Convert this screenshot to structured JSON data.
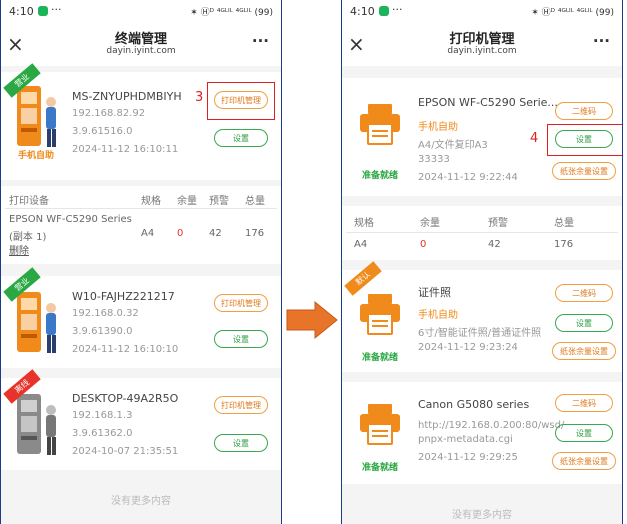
{
  "status": {
    "time": "4:10",
    "app_badge": "green-app-icon",
    "dots": "···",
    "right": "✶ Ⓗᴰ ⁴ᴳᴸᴵᴸ ⁴ᴳᴸᴵᴸ (99)"
  },
  "left": {
    "header": {
      "close": "×",
      "title": "终端管理",
      "subtitle": "dayin.iyint.com",
      "more": "···"
    },
    "terminals": [
      {
        "ribbon": "营业",
        "ribbon_color": "#2aa843",
        "name": "MS-ZNYUPHDMBIYH",
        "ip": "192.168.82.92",
        "version": "3.9.61516.0",
        "time": "2024-11-12 16:10:11",
        "label": "手机自助",
        "btn1": "打印机管理",
        "btn2": "设置",
        "annotation": "3"
      },
      {
        "ribbon": "营业",
        "ribbon_color": "#2aa843",
        "name": "W10-FAJHZ221217",
        "ip": "192.168.0.32",
        "version": "3.9.61390.0",
        "time": "2024-11-12 16:10:10",
        "btn1": "打印机管理",
        "btn2": "设置"
      },
      {
        "ribbon": "离线",
        "ribbon_color": "#e8332a",
        "name": "DESKTOP-49A2R5O",
        "ip": "192.168.1.3",
        "version": "3.9.61362.0",
        "time": "2024-10-07 21:35:51",
        "btn1": "打印机管理",
        "btn2": "设置"
      }
    ],
    "device_table": {
      "headers": [
        "打印设备",
        "规格",
        "余量",
        "预警",
        "总量"
      ],
      "row": {
        "device": "EPSON WF-C5290 Series",
        "device_sub": "(副本 1)",
        "spec": "A4",
        "remain": "0",
        "warn": "42",
        "total": "176",
        "delete": "删除"
      }
    },
    "footer": "没有更多内容"
  },
  "right": {
    "header": {
      "close": "×",
      "title": "打印机管理",
      "subtitle": "dayin.iyint.com",
      "more": "···"
    },
    "printers": [
      {
        "name": "EPSON WF-C5290 Serie...",
        "mode": "手机自助",
        "desc": "A4/文件复印A3",
        "desc2": "33333",
        "time": "2024-11-12 9:22:44",
        "status": "准备就绪",
        "btn1": "二维码",
        "btn2": "设置",
        "btn3": "纸张余量设置",
        "annotation": "4"
      },
      {
        "ribbon": "默认",
        "ribbon_color": "#f08a1a",
        "name": "证件照",
        "mode": "手机自助",
        "desc": "6寸/智能证件照/普通证件照",
        "time": "2024-11-12 9:23:24",
        "status": "准备就绪",
        "btn1": "二维码",
        "btn2": "设置",
        "btn3": "纸张余量设置"
      },
      {
        "name": "Canon G5080 series",
        "url1": "http://192.168.0.200:80/wsd/",
        "url2": "pnpx-metadata.cgi",
        "time": "2024-11-12 9:29:25",
        "status": "准备就绪",
        "btn1": "二维码",
        "btn2": "设置",
        "btn3": "纸张余量设置"
      }
    ],
    "paper_table": {
      "headers": [
        "规格",
        "余量",
        "预警",
        "总量"
      ],
      "row": [
        "A4",
        "0",
        "42",
        "176"
      ]
    },
    "footer": "没有更多内容"
  },
  "colors": {
    "green": "#2aa843",
    "orange": "#f08a1a",
    "red": "#e8332a",
    "frame": "#1e3a8a",
    "arrow": "#e8742a"
  }
}
